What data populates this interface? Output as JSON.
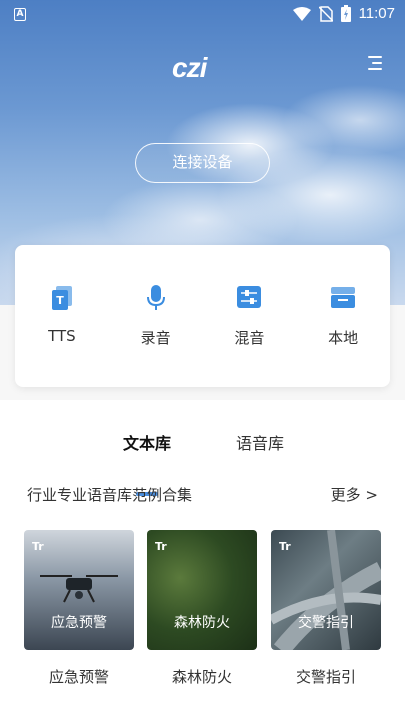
{
  "status_bar": {
    "time": "11:07",
    "notification_icon": "A"
  },
  "header": {
    "logo": "czi",
    "connect_label": "连接设备"
  },
  "functions": [
    {
      "label": "TTS",
      "icon": "tts-icon"
    },
    {
      "label": "录音",
      "icon": "microphone-icon"
    },
    {
      "label": "混音",
      "icon": "mixer-icon"
    },
    {
      "label": "本地",
      "icon": "local-storage-icon"
    }
  ],
  "tabs": [
    {
      "label": "文本库"
    },
    {
      "label": "语音库"
    }
  ],
  "section": {
    "title": "行业专业语音库范例合集",
    "more_label": "更多 >"
  },
  "thumbnails": [
    {
      "caption": "应急预警",
      "label": "应急预警"
    },
    {
      "caption": "森林防火",
      "label": "森林防火"
    },
    {
      "caption": "交警指引",
      "label": "交警指引"
    }
  ],
  "colors": {
    "accent": "#4a90e2",
    "icon_blue": "#3b8de0"
  }
}
